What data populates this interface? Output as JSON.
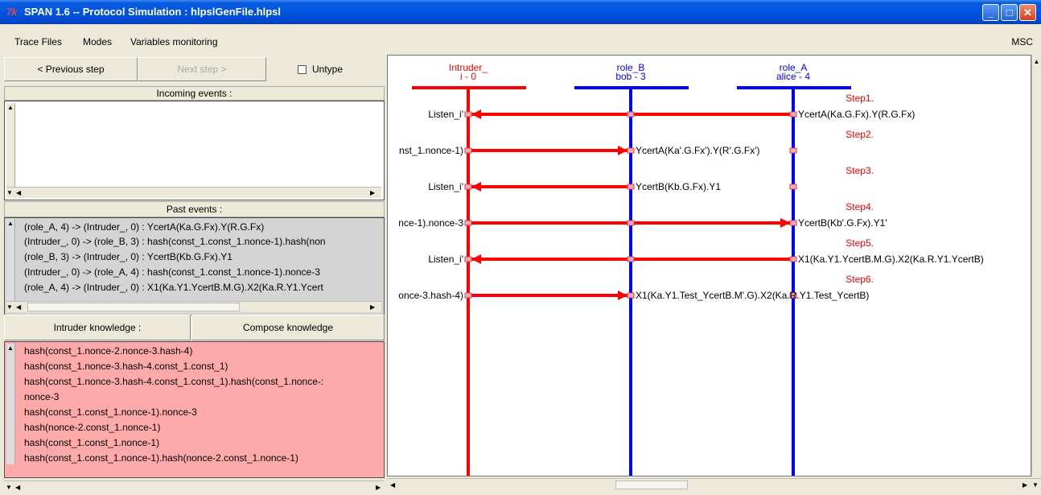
{
  "window": {
    "title": "SPAN 1.6 -- Protocol Simulation : hlpslGenFile.hlpsl",
    "icon_label": "7k"
  },
  "menu": {
    "items": [
      "Trace Files",
      "Modes",
      "Variables monitoring"
    ],
    "msc": "MSC"
  },
  "controls": {
    "prev": "< Previous step",
    "next": "Next step >",
    "untype": "Untype"
  },
  "incoming": {
    "header": "Incoming events :"
  },
  "past": {
    "header": "Past events :",
    "lines": [
      "(role_A, 4) -> (Intruder_, 0) : YcertA(Ka.G.Fx).Y(R.G.Fx)",
      "(Intruder_, 0) -> (role_B, 3) : hash(const_1.const_1.nonce-1).hash(non",
      "(role_B, 3) -> (Intruder_, 0) : YcertB(Kb.G.Fx).Y1",
      "(Intruder_, 0) -> (role_A, 4) : hash(const_1.const_1.nonce-1).nonce-3",
      "(role_A, 4) -> (Intruder_, 0) : X1(Ka.Y1.YcertB.M.G).X2(Ka.R.Y1.Ycert"
    ]
  },
  "knowledge": {
    "intruder_label": "Intruder knowledge :",
    "compose_label": "Compose knowledge",
    "lines": [
      "hash(const_1.nonce-2.nonce-3.hash-4)",
      "hash(const_1.nonce-3.hash-4.const_1.const_1)",
      "hash(const_1.nonce-3.hash-4.const_1.const_1).hash(const_1.nonce-:",
      "nonce-3",
      "hash(const_1.const_1.nonce-1).nonce-3",
      "hash(nonce-2.const_1.nonce-1)",
      "hash(const_1.const_1.nonce-1)",
      "hash(const_1.const_1.nonce-1).hash(nonce-2.const_1.nonce-1)"
    ]
  },
  "msc": {
    "roles": [
      {
        "name": "Intruder_",
        "sub": "i - 0",
        "color": "#ff0000"
      },
      {
        "name": "role_B",
        "sub": "bob - 3",
        "color": "#0000ff"
      },
      {
        "name": "role_A",
        "sub": "alice - 4",
        "color": "#0000ff"
      }
    ],
    "steps": [
      {
        "label": "Step1.",
        "left": "Listen_i'",
        "right": "YcertA(Ka.G.Fx).Y(R.G.Fx)"
      },
      {
        "label": "Step2.",
        "left": "nst_1.nonce-1)",
        "right": "YcertA(Ka'.G.Fx').Y(R'.G.Fx')"
      },
      {
        "label": "Step3.",
        "left": "Listen_i'",
        "right": "YcertB(Kb.G.Fx).Y1"
      },
      {
        "label": "Step4.",
        "left": "nce-1).nonce-3",
        "right": "YcertB(Kb'.G.Fx).Y1'"
      },
      {
        "label": "Step5.",
        "left": "Listen_i'",
        "right": "X1(Ka.Y1.YcertB.M.G).X2(Ka.R.Y1.YcertB)"
      },
      {
        "label": "Step6.",
        "left": "once-3.hash-4)",
        "right": "X1(Ka.Y1.Test_YcertB.M'.G).X2(Ka.R.Y1.Test_YcertB)"
      }
    ],
    "accent": "#ff0000"
  }
}
